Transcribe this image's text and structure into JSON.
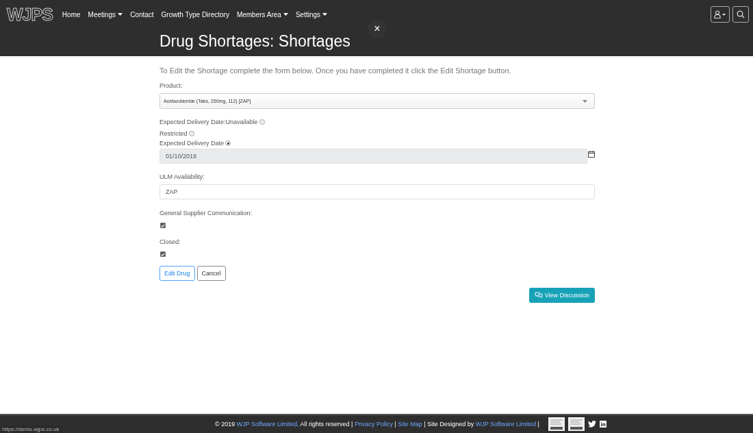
{
  "logo": "WJPS",
  "nav": [
    {
      "label": "Home",
      "dropdown": false
    },
    {
      "label": "Meetings",
      "dropdown": true
    },
    {
      "label": "Contact",
      "dropdown": false
    },
    {
      "label": "Growth Type Directory",
      "dropdown": false
    },
    {
      "label": "Members Area",
      "dropdown": true
    },
    {
      "label": "Settings",
      "dropdown": true
    }
  ],
  "close": "×",
  "title": "Drug Shortages: Shortages",
  "intro": "To Edit the Shortage complete the form below. Once you have completed it click the Edit Shortage button.",
  "fields": [
    {
      "kind": "select",
      "label": "Product:",
      "value": "Acetazolamide (Tabs, 250mg, 112) [ZAP]"
    },
    {
      "kind": "radios",
      "options": [
        {
          "label": "Expected Delivery Date:Unavailable",
          "selected": false
        },
        {
          "label": "Restricted",
          "selected": false
        },
        {
          "label": "Expected Delivery Date",
          "selected": true
        }
      ]
    },
    {
      "kind": "date",
      "value": "01/10/2019",
      "disabled": true
    },
    {
      "kind": "text",
      "label": "ULM Availability:",
      "value": "ZAP"
    },
    {
      "kind": "checkbox",
      "label": "General Supplier Communication:",
      "checked": true
    },
    {
      "kind": "checkbox",
      "label": "Closed:",
      "checked": true
    }
  ],
  "buttons": [
    {
      "label": "Edit Drug",
      "kind": "primary"
    },
    {
      "label": "Cancel",
      "kind": "secondary"
    }
  ],
  "discussion_button": "View Discussion",
  "footer": [
    {
      "kind": "text",
      "text": "© 2019 "
    },
    {
      "kind": "link",
      "text": "WJP Software Limited,"
    },
    {
      "kind": "text",
      "text": " All rights reserved | "
    },
    {
      "kind": "link",
      "text": "Privacy Policy"
    },
    {
      "kind": "text",
      "text": " | "
    },
    {
      "kind": "link",
      "text": "Site Map"
    },
    {
      "kind": "text",
      "text": " | Site Designed by "
    },
    {
      "kind": "link",
      "text": "WJP Software Limited"
    },
    {
      "kind": "text",
      "text": " |"
    }
  ],
  "status_url": "https://demo.wjps.co.uk"
}
